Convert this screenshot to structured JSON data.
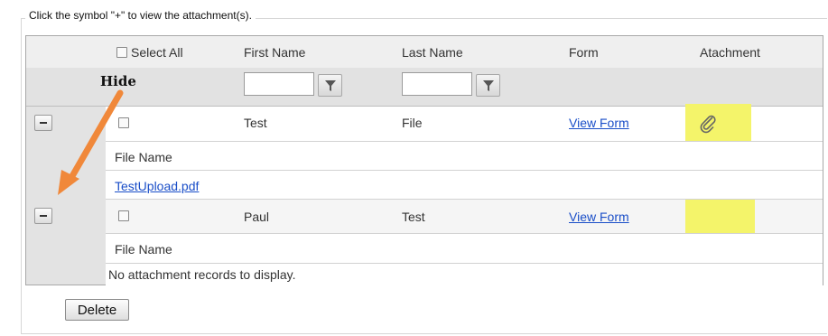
{
  "instruction": "Click the symbol \"+\" to view the attachment(s).",
  "header": {
    "select_all": "Select All",
    "first_name": "First Name",
    "last_name": "Last Name",
    "form": "Form",
    "attachment": "Atachment"
  },
  "annotation": {
    "hide_label": "Hide",
    "arrow_color": "#f0883a",
    "highlight_color": "#f4f46a"
  },
  "rows": [
    {
      "first_name": "Test",
      "last_name": "File",
      "form_link": "View Form",
      "attachment_icon": "paperclip-icon",
      "detail": {
        "header": "File Name",
        "files": [
          "TestUpload.pdf"
        ]
      }
    },
    {
      "first_name": "Paul",
      "last_name": "Test",
      "form_link": "View Form",
      "detail": {
        "header": "File Name",
        "empty_message": "No attachment records to display."
      }
    }
  ],
  "footer": {
    "delete_label": "Delete"
  }
}
